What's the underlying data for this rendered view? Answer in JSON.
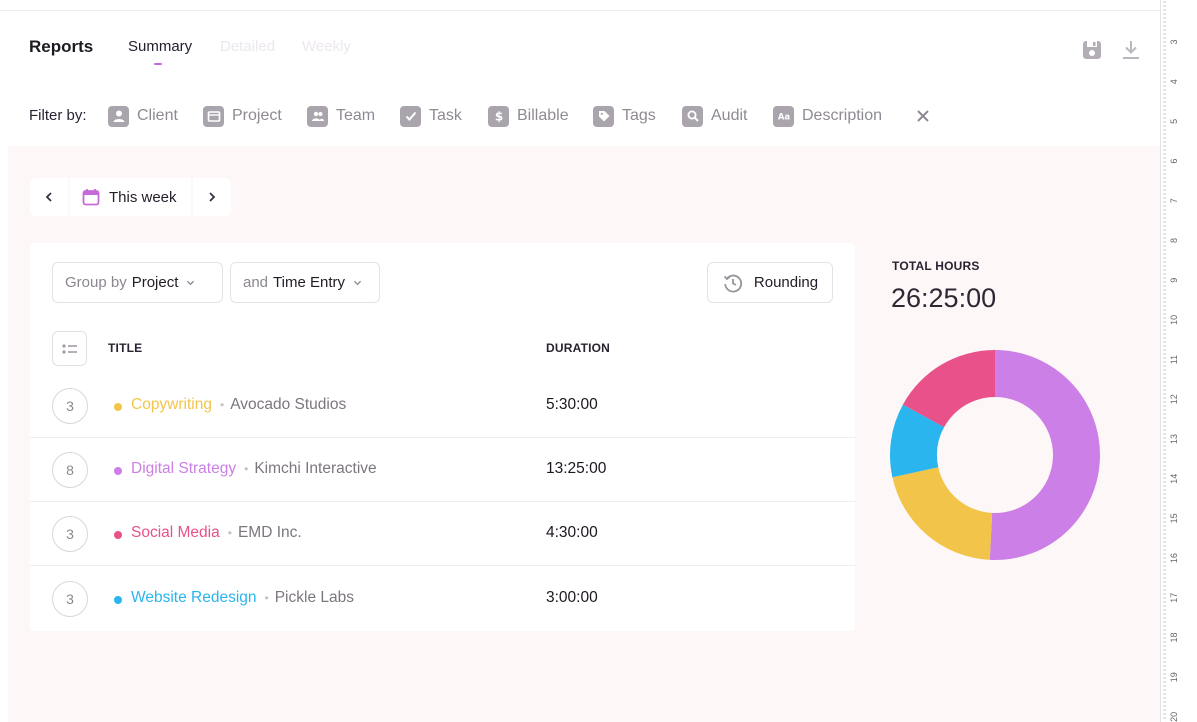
{
  "header": {
    "title": "Reports",
    "tabs": [
      {
        "label": "Summary",
        "active": true
      },
      {
        "label": "Detailed",
        "active": false
      },
      {
        "label": "Weekly",
        "active": false
      }
    ]
  },
  "filters": {
    "label": "Filter by:",
    "items": [
      {
        "label": "Client",
        "icon": "user-icon"
      },
      {
        "label": "Project",
        "icon": "folder-icon"
      },
      {
        "label": "Team",
        "icon": "team-icon"
      },
      {
        "label": "Task",
        "icon": "check-icon"
      },
      {
        "label": "Billable",
        "icon": "dollar-icon"
      },
      {
        "label": "Tags",
        "icon": "tag-icon"
      },
      {
        "label": "Audit",
        "icon": "search-icon"
      },
      {
        "label": "Description",
        "icon": "text-icon"
      }
    ]
  },
  "date_range": {
    "label": "This week"
  },
  "grouping": {
    "group_by_prefix": "Group by",
    "group_by_value": "Project",
    "and_prefix": "and",
    "and_value": "Time Entry",
    "rounding_label": "Rounding"
  },
  "table": {
    "columns": {
      "title": "TITLE",
      "duration": "DURATION"
    },
    "rows": [
      {
        "count": "3",
        "project": "Copywriting",
        "client": "Avocado Studios",
        "duration": "5:30:00",
        "color": "#f2c54a"
      },
      {
        "count": "8",
        "project": "Digital Strategy",
        "client": "Kimchi Interactive",
        "duration": "13:25:00",
        "color": "#cc7fe6"
      },
      {
        "count": "3",
        "project": "Social Media",
        "client": "EMD Inc.",
        "duration": "4:30:00",
        "color": "#e8518a"
      },
      {
        "count": "3",
        "project": "Website Redesign",
        "client": "Pickle Labs",
        "duration": "3:00:00",
        "color": "#2ab5ee"
      }
    ]
  },
  "total": {
    "label": "TOTAL HOURS",
    "value": "26:25:00"
  },
  "chart_data": {
    "type": "pie",
    "categories": [
      "Digital Strategy",
      "Copywriting",
      "Website Redesign",
      "Social Media"
    ],
    "values": [
      13.4167,
      5.5,
      3.0,
      4.5
    ],
    "colors": [
      "#cc7fe6",
      "#f2c54a",
      "#2ab5ee",
      "#e8518a"
    ],
    "donut": true
  },
  "ruler": {
    "labels": [
      "3",
      "4",
      "5",
      "6",
      "7",
      "8",
      "9",
      "10",
      "11",
      "12",
      "13",
      "14",
      "15",
      "16",
      "17",
      "18",
      "19",
      "20"
    ]
  }
}
